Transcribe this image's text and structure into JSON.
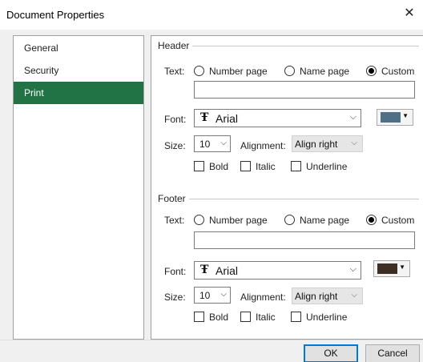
{
  "window": {
    "title": "Document Properties",
    "close_glyph": "✕"
  },
  "sidebar": {
    "items": [
      {
        "label": "General"
      },
      {
        "label": "Security"
      },
      {
        "label": "Print"
      }
    ],
    "selected": "Print"
  },
  "header": {
    "group_title": "Header",
    "text_label": "Text:",
    "radio_options": [
      "Number page",
      "Name page",
      "Custom"
    ],
    "selected_option": "Custom",
    "custom_text_value": "",
    "font_label": "Font:",
    "font_value": "Arial",
    "font_icon_glyph": "Ŧ",
    "color_swatch": "#4e6f85",
    "size_label": "Size:",
    "size_value": "10",
    "alignment_label": "Alignment:",
    "alignment_value": "Align right",
    "bold_label": "Bold",
    "italic_label": "Italic",
    "underline_label": "Underline",
    "bold": false,
    "italic": false,
    "underline": false
  },
  "footer": {
    "group_title": "Footer",
    "text_label": "Text:",
    "radio_options": [
      "Number page",
      "Name page",
      "Custom"
    ],
    "selected_option": "Custom",
    "custom_text_value": "",
    "font_label": "Font:",
    "font_value": "Arial",
    "font_icon_glyph": "Ŧ",
    "color_swatch": "#3e2f25",
    "size_label": "Size:",
    "size_value": "10",
    "alignment_label": "Alignment:",
    "alignment_value": "Align right",
    "bold_label": "Bold",
    "italic_label": "Italic",
    "underline_label": "Underline",
    "bold": false,
    "italic": false,
    "underline": false
  },
  "buttons": {
    "ok_label": "OK",
    "cancel_label": "Cancel"
  },
  "glyphs": {
    "chevron_down": "⌵",
    "dropdown_arrow": "▼"
  },
  "colors": {
    "accent": "#217346",
    "primary_border": "#0078d7"
  }
}
